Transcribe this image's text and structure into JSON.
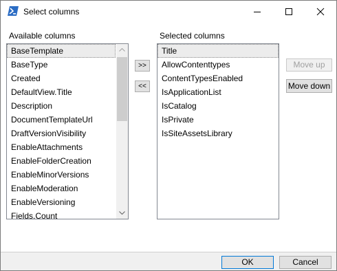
{
  "window": {
    "title": "Select columns",
    "icon": "powershell-icon",
    "controls": [
      "minimize-icon",
      "maximize-icon",
      "close-icon"
    ]
  },
  "available": {
    "label": "Available columns",
    "items": [
      "BaseTemplate",
      "BaseType",
      "Created",
      "DefaultView.Title",
      "Description",
      "DocumentTemplateUrl",
      "DraftVersionVisibility",
      "EnableAttachments",
      "EnableFolderCreation",
      "EnableMinorVersions",
      "EnableModeration",
      "EnableVersioning",
      "Fields.Count"
    ]
  },
  "selected": {
    "label": "Selected columns",
    "items": [
      "Title",
      "AllowContenttypes",
      "ContentTypesEnabled",
      "IsApplicationList",
      "IsCatalog",
      "IsPrivate",
      "IsSiteAssetsLibrary"
    ]
  },
  "buttons": {
    "add": ">>",
    "remove": "<<",
    "move_up": "Move up",
    "move_down": "Move down",
    "ok": "OK",
    "cancel": "Cancel"
  },
  "colors": {
    "ok_border": "#0078d7",
    "powershell_blue": "#2b6cc4"
  }
}
